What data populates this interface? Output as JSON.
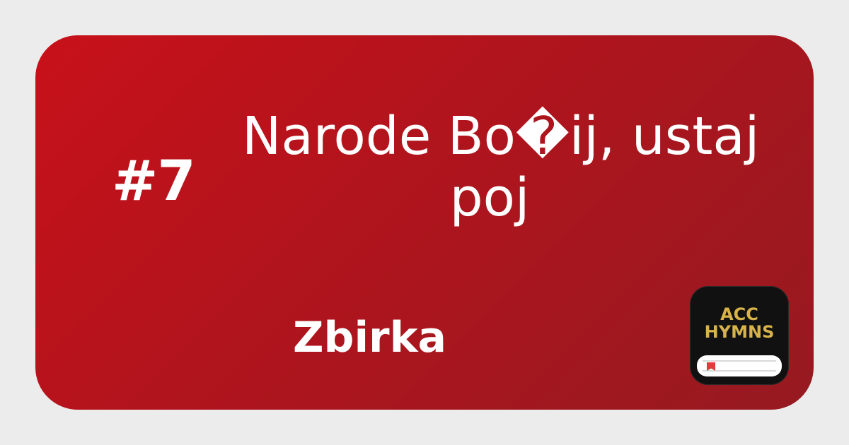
{
  "hymn": {
    "number": "#7",
    "title_lines": [
      "Narode Bo�ij, ustaj",
      "poj"
    ],
    "collection": "Zbirka"
  },
  "app": {
    "icon_lines": [
      "ACC",
      "HYMNS"
    ],
    "icon_name": "book-icon",
    "accent_color": "#d8b24a",
    "bookmark_color": "#e23b3b"
  },
  "colors": {
    "page_background": "#ececec",
    "card_start": "#c8111a",
    "card_end": "#961a20",
    "text": "#ffffff"
  }
}
